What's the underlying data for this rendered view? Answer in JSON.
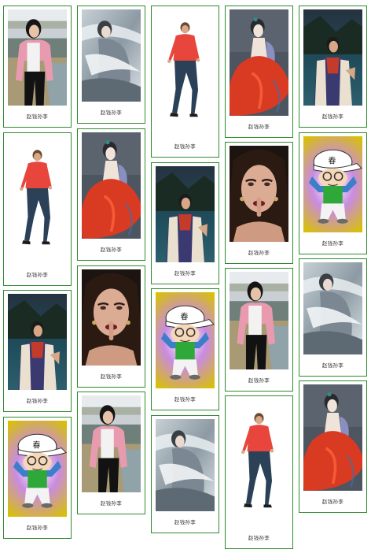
{
  "page": {
    "background": "#ffffff",
    "card_border_color": "#2e8b2e"
  },
  "gallery": {
    "items": [
      {
        "caption": "赵钱孙李",
        "image": "woman-pink-cardigan-photo"
      },
      {
        "caption": "赵钱孙李",
        "image": "ink-wash-fairy-painting"
      },
      {
        "caption": "赵钱孙李",
        "image": "man-red-shirt-walking-photo"
      },
      {
        "caption": "赵钱孙李",
        "image": "woman-red-gown-painting"
      },
      {
        "caption": "赵钱孙李",
        "image": "woman-lakeside-photo"
      },
      {
        "caption": "赵钱孙李",
        "image": "man-red-shirt-walking-photo"
      },
      {
        "caption": "赵钱孙李",
        "image": "woman-red-gown-painting"
      },
      {
        "caption": "赵钱孙李",
        "image": "woman-lakeside-photo"
      },
      {
        "caption": "赵钱孙李",
        "image": "woman-portrait-finger-lips"
      },
      {
        "caption": "赵钱孙李",
        "image": "cartoon-boy-white-cap"
      },
      {
        "caption": "赵钱孙李",
        "image": "woman-lakeside-photo"
      },
      {
        "caption": "赵钱孙李",
        "image": "woman-portrait-finger-lips"
      },
      {
        "caption": "赵钱孙李",
        "image": "cartoon-boy-white-cap"
      },
      {
        "caption": "赵钱孙李",
        "image": "woman-pink-cardigan-photo"
      },
      {
        "caption": "赵钱孙李",
        "image": "ink-wash-fairy-painting"
      },
      {
        "caption": "赵钱孙李",
        "image": "cartoon-boy-white-cap"
      },
      {
        "caption": "赵钱孙李",
        "image": "woman-pink-cardigan-photo"
      },
      {
        "caption": "赵钱孙李",
        "image": "ink-wash-fairy-painting"
      },
      {
        "caption": "赵钱孙李",
        "image": "man-red-shirt-walking-photo"
      },
      {
        "caption": "赵钱孙李",
        "image": "woman-red-gown-painting"
      }
    ]
  }
}
